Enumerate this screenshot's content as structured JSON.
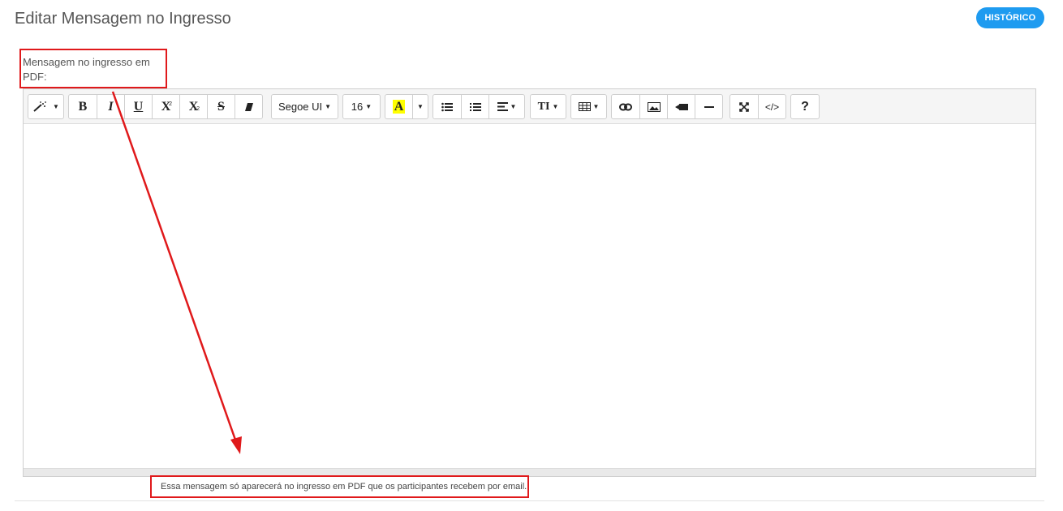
{
  "header": {
    "title": "Editar Mensagem no Ingresso",
    "history_button": "HISTÓRICO"
  },
  "field": {
    "label": "Mensagem no ingresso em PDF:"
  },
  "toolbar": {
    "bold": "B",
    "italic": "I",
    "underline": "U",
    "superscript": "X",
    "subscript": "X",
    "strike": "S",
    "font_family": "Segoe UI",
    "font_size": "16",
    "highlight_letter": "A",
    "text_size_icon": "TI",
    "code_view": "</>",
    "help": "?"
  },
  "helper_text": "Essa mensagem só aparecerá no ingresso em PDF que os participantes recebem por email.",
  "colors": {
    "accent": "#1e9bf0",
    "annotation": "#e0191b",
    "highlight": "#ffff00"
  },
  "icons": [
    "magic-wand-icon",
    "eraser-icon",
    "unordered-list-icon",
    "ordered-list-icon",
    "align-icon",
    "table-icon",
    "link-icon",
    "image-icon",
    "video-icon",
    "horizontal-rule-icon",
    "fullscreen-icon",
    "code-icon",
    "help-icon"
  ]
}
